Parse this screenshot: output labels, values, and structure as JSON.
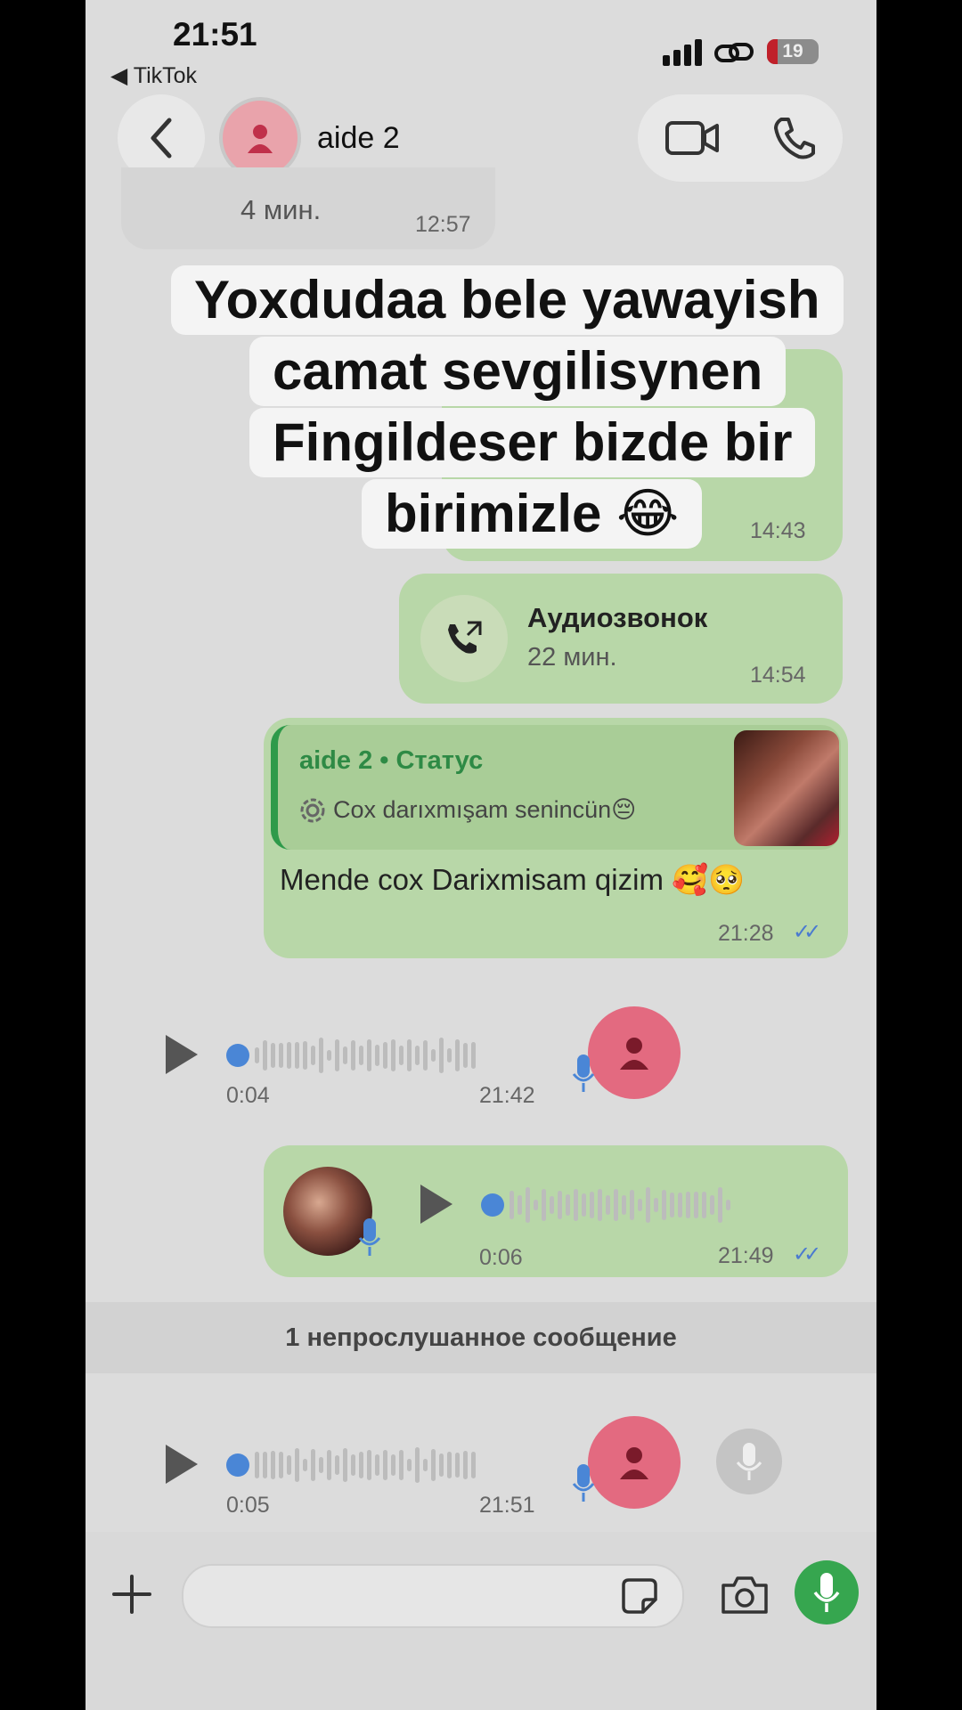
{
  "status_bar": {
    "time": "21:51",
    "back_app": "◀ TikTok",
    "battery": "19"
  },
  "header": {
    "contact_name": "aide 2"
  },
  "messages": {
    "prev_call_duration": "4 мин.",
    "prev_call_time": "12:57",
    "hidden_bubble_time": "14:43",
    "audio_call_title": "Аудиозвонок",
    "audio_call_duration": "22 мин.",
    "audio_call_time": "14:54",
    "reply_header": "aide 2 • Статус",
    "reply_status_text": "Cox darıxmışam senincün😔",
    "reply_message": "Mende cox  Darixmisam qizim 🥰🥺",
    "reply_time": "21:28",
    "voice1_duration": "0:04",
    "voice1_time": "21:42",
    "voice2_duration": "0:06",
    "voice2_time": "21:49",
    "unread_label": "1 непрослушанное сообщение",
    "voice3_duration": "0:05",
    "voice3_time": "21:51"
  },
  "overlay_caption": {
    "line1": "Yoxdudaa bele  yawayish",
    "line2": "camat  sevgilisynen",
    "line3": "Fingildeser bizde bir",
    "line4": "birimizle 😂"
  },
  "colors": {
    "outgoing_bubble": "#b8d7a8",
    "accent_green": "#36a64f",
    "tick_blue": "#4a7ad0",
    "avatar_pink": "#e36a80"
  }
}
